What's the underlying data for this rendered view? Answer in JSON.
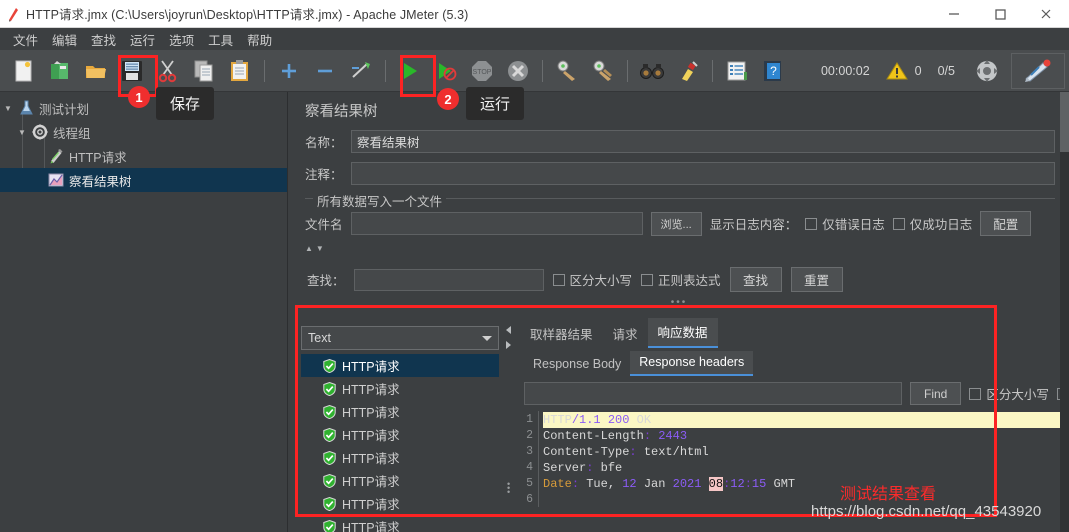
{
  "window": {
    "title": "HTTP请求.jmx (C:\\Users\\joyrun\\Desktop\\HTTP请求.jmx) - Apache JMeter (5.3)",
    "app_icon": "jmeter-feather-icon",
    "minimize": "—",
    "maximize": "□",
    "close": "✕"
  },
  "menubar": {
    "items": [
      {
        "label": "文件"
      },
      {
        "label": "编辑"
      },
      {
        "label": "查找"
      },
      {
        "label": "运行"
      },
      {
        "label": "选项"
      },
      {
        "label": "工具"
      },
      {
        "label": "帮助"
      }
    ]
  },
  "toolbar": {
    "buttons": [
      {
        "name": "new-icon"
      },
      {
        "name": "templates-icon"
      },
      {
        "name": "open-icon"
      },
      {
        "name": "save-icon"
      },
      {
        "name": "cut-icon"
      },
      {
        "name": "copy-icon"
      },
      {
        "name": "paste-icon"
      },
      {
        "name": "expand-all-icon"
      },
      {
        "name": "collapse-all-icon"
      },
      {
        "name": "toggle-icon"
      },
      {
        "name": "start-icon"
      },
      {
        "name": "start-no-pauses-icon"
      },
      {
        "name": "stop-icon"
      },
      {
        "name": "shutdown-icon"
      },
      {
        "name": "clear-icon"
      },
      {
        "name": "clear-all-icon"
      },
      {
        "name": "search-icon"
      },
      {
        "name": "reset-search-icon"
      },
      {
        "name": "function-helper-icon"
      },
      {
        "name": "help-icon"
      }
    ],
    "status": {
      "elapsed_time": "00:00:02",
      "warning_count": "0",
      "thread_count": "0/5"
    }
  },
  "tree": {
    "items": [
      {
        "label": "测试计划",
        "icon": "test-plan-icon",
        "level": 0,
        "expanded": true,
        "selected": false
      },
      {
        "label": "线程组",
        "icon": "thread-group-icon",
        "level": 1,
        "expanded": true,
        "selected": false
      },
      {
        "label": "HTTP请求",
        "icon": "http-request-icon",
        "level": 2,
        "expanded": false,
        "selected": false
      },
      {
        "label": "察看结果树",
        "icon": "view-results-tree-icon",
        "level": 2,
        "expanded": false,
        "selected": true
      }
    ]
  },
  "main": {
    "panel_title": "察看结果树",
    "name_label": "名称：",
    "name_value": "察看结果树",
    "comment_label": "注释：",
    "comment_value": "",
    "group_label": "所有数据写入一个文件",
    "filename_label": "文件名",
    "filename_value": "",
    "browse_button": "浏览...",
    "log_display_label": "显示日志内容：",
    "errors_only_label": "仅错误日志",
    "success_only_label": "仅成功日志",
    "configure_button": "配置",
    "search_label": "查找：",
    "search_value": "",
    "match_case_label": "区分大小写",
    "regex_label": "正则表达式",
    "search_button": "查找",
    "reset_button": "重置"
  },
  "results": {
    "renderer_selected": "Text",
    "items": [
      {
        "label": "HTTP请求",
        "status": "success",
        "selected": true
      },
      {
        "label": "HTTP请求",
        "status": "success",
        "selected": false
      },
      {
        "label": "HTTP请求",
        "status": "success",
        "selected": false
      },
      {
        "label": "HTTP请求",
        "status": "success",
        "selected": false
      },
      {
        "label": "HTTP请求",
        "status": "success",
        "selected": false
      },
      {
        "label": "HTTP请求",
        "status": "success",
        "selected": false
      },
      {
        "label": "HTTP请求",
        "status": "success",
        "selected": false
      },
      {
        "label": "HTTP请求",
        "status": "success",
        "selected": false
      }
    ],
    "tabs": [
      {
        "label": "取样器结果",
        "active": false
      },
      {
        "label": "请求",
        "active": false
      },
      {
        "label": "响应数据",
        "active": true
      }
    ],
    "subtabs": [
      {
        "label": "Response Body",
        "active": false
      },
      {
        "label": "Response headers",
        "active": true
      }
    ],
    "find_value": "",
    "find_button": "Find",
    "find_match_case_label": "区分大小写",
    "response": {
      "lines": [
        {
          "no": "1",
          "text": "HTTP/1.1 200 OK"
        },
        {
          "no": "2",
          "text": "Content-Length: 2443"
        },
        {
          "no": "3",
          "text": "Content-Type: text/html"
        },
        {
          "no": "4",
          "text": "Server: bfe"
        },
        {
          "no": "5",
          "text": "Date: Tue, 12 Jan 2021 08:12:15 GMT"
        },
        {
          "no": "6",
          "text": ""
        }
      ]
    }
  },
  "annotations": {
    "callouts": [
      {
        "badge": "1",
        "label": "保存"
      },
      {
        "badge": "2",
        "label": "运行"
      }
    ],
    "watermark_text": "测试结果查看",
    "watermark_url": "https://blog.csdn.net/qq_43543920",
    "highlight_color": "#fd2323"
  }
}
